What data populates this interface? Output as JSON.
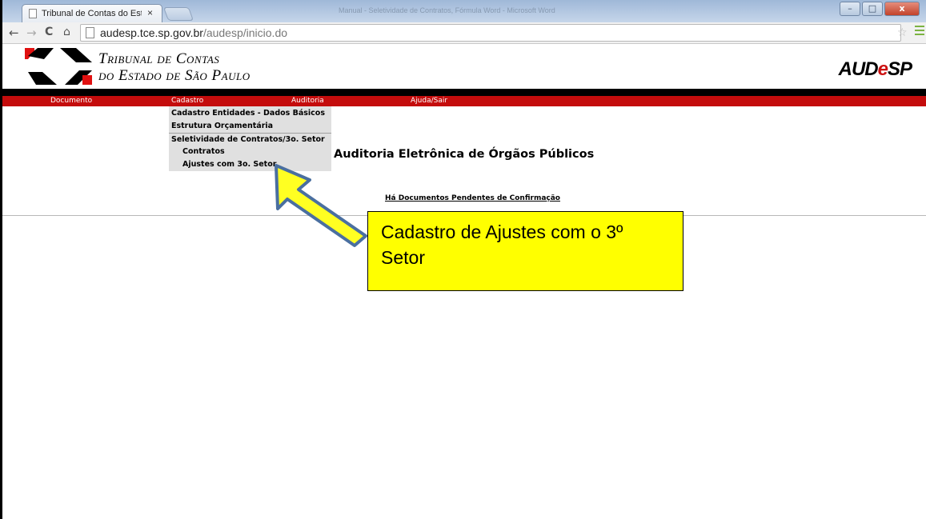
{
  "browser": {
    "tab_title": "Tribunal de Contas do Est",
    "tab_close": "×",
    "background_window_title": "Manual - Seletividade de Contratos, Fórmula Word - Microsoft Word",
    "window_buttons": {
      "minimize": "–",
      "maximize": "□",
      "close": "x"
    },
    "url_host": "audesp.tce.sp.gov.br",
    "url_path": "/audesp/inicio.do",
    "icons": [
      "back-arrow",
      "forward-arrow",
      "reload",
      "home",
      "page",
      "star",
      "chrome-menu"
    ]
  },
  "header": {
    "institution_line1": "Tribunal de Contas",
    "institution_line2": "do Estado de São Paulo",
    "logo_prefix": "AUD",
    "logo_e": "e",
    "logo_suffix": "SP",
    "colors": {
      "red": "#c40c0c",
      "black": "#000000"
    }
  },
  "nav": {
    "items": [
      "Documento",
      "Cadastro",
      "Auditoria",
      "Ajuda/Sair"
    ]
  },
  "dropdown": {
    "items": [
      "Cadastro Entidades - Dados Básicos",
      "Estrutura Orçamentária",
      "Seletividade de Contratos/3o. Setor",
      "Contratos",
      "Ajustes com 3o. Setor"
    ]
  },
  "main": {
    "title": "Auditoria Eletrônica de Órgãos Públicos",
    "pending_link": "Há Documentos Pendentes de Confirmação"
  },
  "annotation": {
    "text": "Cadastro de Ajustes com o 3º Setor",
    "color": "#ffff00"
  }
}
